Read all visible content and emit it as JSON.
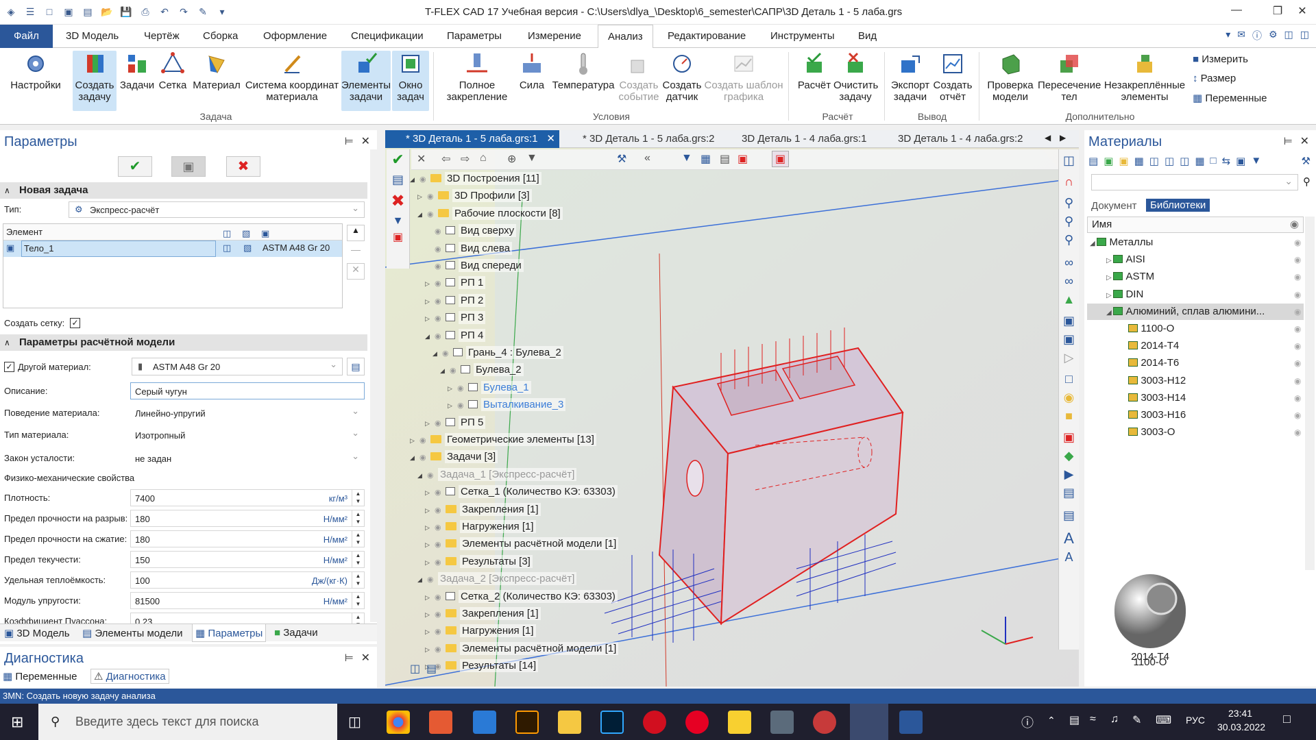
{
  "window": {
    "title": "T-FLEX CAD 17 Учебная версия - C:\\Users\\dlya_\\Desktop\\6_semester\\САПР\\3D Деталь 1 - 5 лаба.grs"
  },
  "menu": {
    "tabs": [
      "Файл",
      "3D Модель",
      "Чертёж",
      "Сборка",
      "Оформление",
      "Спецификации",
      "Параметры",
      "Измерение",
      "Анализ",
      "Редактирование",
      "Инструменты",
      "Вид"
    ],
    "active": "Анализ"
  },
  "ribbon": {
    "buttons": {
      "settings": "Настройки",
      "create_task": "Создать задачу",
      "tasks": "Задачи",
      "mesh": "Сетка",
      "material": "Материал",
      "mat_coord": "Система координат материала",
      "task_elements": "Элементы задачи",
      "task_window": "Окно задач",
      "full_fix": "Полное закрепление",
      "force": "Сила",
      "temperature": "Температура",
      "create_event": "Создать событие",
      "create_sensor": "Создать датчик",
      "create_chart_template": "Создать шаблон графика",
      "calc": "Расчёт",
      "clear_task": "Очистить задачу",
      "export_task": "Экспорт задачи",
      "create_report": "Создать отчёт",
      "check_model": "Проверка модели",
      "body_intersection": "Пересечение тел",
      "unfixed_elements": "Незакреплённые элементы",
      "measure": "Измерить",
      "size": "Размер",
      "variables": "Переменные"
    },
    "groups": {
      "task": "Задача",
      "conditions": "Условия",
      "calc": "Расчёт",
      "output": "Вывод",
      "extra": "Дополнительно"
    }
  },
  "params_panel": {
    "title": "Параметры",
    "section_new_task": "Новая задача",
    "type_label": "Тип:",
    "type_value": "Экспресс-расчёт",
    "element_col": "Элемент",
    "element_row_name": "Тело_1",
    "element_row_material": "ASTM A48 Gr 20",
    "create_mesh_label": "Создать сетку:",
    "section_model": "Параметры расчётной модели",
    "other_material_label": "Другой материал:",
    "other_material_value": "ASTM A48 Gr 20",
    "fields": [
      {
        "label": "Описание:",
        "value": "Серый чугун",
        "unit": ""
      },
      {
        "label": "Поведение материала:",
        "value": "Линейно-упругий",
        "unit": ""
      },
      {
        "label": "Тип материала:",
        "value": "Изотропный",
        "unit": ""
      },
      {
        "label": "Закон усталости:",
        "value": "не задан",
        "unit": ""
      }
    ],
    "phys_title": "Физико-механические свойства",
    "phys": [
      {
        "label": "Плотность:",
        "value": "7400",
        "unit": "кг/м³"
      },
      {
        "label": "Предел прочности на разрыв:",
        "value": "180",
        "unit": "Н/мм²"
      },
      {
        "label": "Предел прочности на сжатие:",
        "value": "180",
        "unit": "Н/мм²"
      },
      {
        "label": "Предел текучести:",
        "value": "150",
        "unit": "Н/мм²"
      },
      {
        "label": "Удельная теплоёмкость:",
        "value": "100",
        "unit": "Дж/(кг·К)"
      },
      {
        "label": "Модуль упругости:",
        "value": "81500",
        "unit": "Н/мм²"
      },
      {
        "label": "Коэффициент Пуассона:",
        "value": "0.23",
        "unit": ""
      }
    ],
    "bottom_tabs": [
      "3D Модель",
      "Элементы модели",
      "Параметры",
      "Задачи"
    ]
  },
  "diagnostics": {
    "title": "Диагностика",
    "tabs": [
      "Переменные",
      "Диагностика"
    ]
  },
  "doc_tabs": [
    "* 3D Деталь 1 - 5 лаба.grs:1",
    "* 3D Деталь 1 - 5 лаба.grs:2",
    "3D Деталь 1 - 4 лаба.grs:1",
    "3D Деталь 1 - 4 лаба.grs:2"
  ],
  "tree": [
    {
      "t": "3D Построения [11]",
      "l": 0,
      "k": "folder",
      "e": "-"
    },
    {
      "t": "3D Профили [3]",
      "l": 1,
      "k": "folder",
      "e": "+"
    },
    {
      "t": "Рабочие плоскости [8]",
      "l": 1,
      "k": "folder",
      "e": "-"
    },
    {
      "t": "Вид сверху",
      "l": 2,
      "k": "box",
      "e": ""
    },
    {
      "t": "Вид слева",
      "l": 2,
      "k": "box",
      "e": ""
    },
    {
      "t": "Вид спереди",
      "l": 2,
      "k": "box",
      "e": ""
    },
    {
      "t": "РП 1",
      "l": 2,
      "k": "box",
      "e": "+"
    },
    {
      "t": "РП 2",
      "l": 2,
      "k": "box",
      "e": "+"
    },
    {
      "t": "РП 3",
      "l": 2,
      "k": "box",
      "e": "+"
    },
    {
      "t": "РП 4",
      "l": 2,
      "k": "box",
      "e": "-"
    },
    {
      "t": "Грань_4 : Булева_2",
      "l": 3,
      "k": "box",
      "e": "-"
    },
    {
      "t": "Булева_2",
      "l": 4,
      "k": "box",
      "e": "-"
    },
    {
      "t": "Булева_1",
      "l": 5,
      "k": "box",
      "e": "+",
      "c": "blue"
    },
    {
      "t": "Выталкивание_3",
      "l": 5,
      "k": "box",
      "e": "+",
      "c": "blue"
    },
    {
      "t": "РП 5",
      "l": 2,
      "k": "box",
      "e": "+"
    },
    {
      "t": "Геометрические элементы [13]",
      "l": 0,
      "k": "folder",
      "e": "+"
    },
    {
      "t": "Задачи [3]",
      "l": 0,
      "k": "folder",
      "e": "-"
    },
    {
      "t": "Задача_1 [Экспресс-расчёт]",
      "l": 1,
      "k": "none",
      "e": "-",
      "c": "gray"
    },
    {
      "t": "Сетка_1 (Количество КЭ: 63303)",
      "l": 2,
      "k": "box",
      "e": "+"
    },
    {
      "t": "Закрепления [1]",
      "l": 2,
      "k": "folder",
      "e": "+"
    },
    {
      "t": "Нагружения [1]",
      "l": 2,
      "k": "folder",
      "e": "+"
    },
    {
      "t": "Элементы расчётной модели [1]",
      "l": 2,
      "k": "folder",
      "e": "+"
    },
    {
      "t": "Результаты [3]",
      "l": 2,
      "k": "folder",
      "e": "+"
    },
    {
      "t": "Задача_2 [Экспресс-расчёт]",
      "l": 1,
      "k": "none",
      "e": "-",
      "c": "gray"
    },
    {
      "t": "Сетка_2 (Количество КЭ: 63303)",
      "l": 2,
      "k": "box",
      "e": "+"
    },
    {
      "t": "Закрепления [1]",
      "l": 2,
      "k": "folder",
      "e": "+"
    },
    {
      "t": "Нагружения [1]",
      "l": 2,
      "k": "folder",
      "e": "+"
    },
    {
      "t": "Элементы расчётной модели [1]",
      "l": 2,
      "k": "folder",
      "e": "+"
    },
    {
      "t": "Результаты [14]",
      "l": 2,
      "k": "folder",
      "e": "+"
    }
  ],
  "materials": {
    "title": "Материалы",
    "tabs": [
      "Документ",
      "Библиотеки"
    ],
    "active_tab": "Библиотеки",
    "col_name": "Имя",
    "tree": [
      {
        "t": "Металлы",
        "l": 0,
        "e": "-"
      },
      {
        "t": "AISI",
        "l": 1,
        "e": "+"
      },
      {
        "t": "ASTM",
        "l": 1,
        "e": "+"
      },
      {
        "t": "DIN",
        "l": 1,
        "e": "+"
      },
      {
        "t": "Алюминий, сплав алюмини...",
        "l": 1,
        "e": "-",
        "sel": true
      },
      {
        "t": "1100-O",
        "l": 2,
        "e": ""
      },
      {
        "t": "2014-T4",
        "l": 2,
        "e": ""
      },
      {
        "t": "2014-T6",
        "l": 2,
        "e": ""
      },
      {
        "t": "3003-H12",
        "l": 2,
        "e": ""
      },
      {
        "t": "3003-H14",
        "l": 2,
        "e": ""
      },
      {
        "t": "3003-H16",
        "l": 2,
        "e": ""
      },
      {
        "t": "3003-O",
        "l": 2,
        "e": ""
      }
    ],
    "previews": [
      "1100-O",
      "2014-T4"
    ]
  },
  "status": {
    "text": "3MN: Создать новую задачу анализа"
  },
  "taskbar": {
    "search_placeholder": "Введите здесь текст для поиска",
    "lang": "РУС",
    "time": "23:41",
    "date": "30.03.2022"
  },
  "colors": {
    "accent": "#2b579a",
    "load": "#e02020",
    "fix": "#2030c0"
  }
}
